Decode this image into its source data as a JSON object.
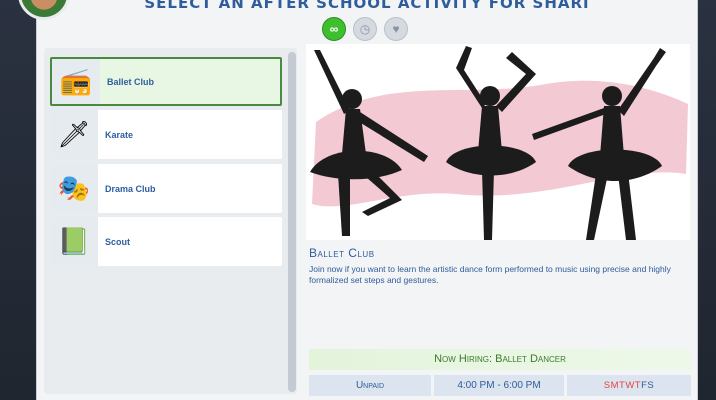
{
  "window": {
    "title": "Select an After School Activity for Shari"
  },
  "mode_buttons": [
    {
      "icon": "infinity-icon",
      "glyph": "∞",
      "active": true
    },
    {
      "icon": "clock-icon",
      "glyph": "◷",
      "active": false
    },
    {
      "icon": "heart-icon",
      "glyph": "♥",
      "active": false
    }
  ],
  "activities": [
    {
      "label": "Ballet Club",
      "icon": "boombox-icon",
      "glyph": "📻",
      "selected": true
    },
    {
      "label": "Karate",
      "icon": "sword-icon",
      "glyph": "🗡",
      "selected": false
    },
    {
      "label": "Drama Club",
      "icon": "masks-icon",
      "glyph": "🎭",
      "selected": false
    },
    {
      "label": "Scout",
      "icon": "scout-book-icon",
      "glyph": "📗",
      "selected": false
    }
  ],
  "detail": {
    "title": "Ballet Club",
    "description": "Join now if you want to learn the artistic dance form performed to music using precise and highly formalized set steps and gestures.",
    "hiring": "Now Hiring: Ballet Dancer",
    "pay": "Unpaid",
    "hours": "4:00 PM - 6:00 PM",
    "days": [
      {
        "d": "S",
        "on": true
      },
      {
        "d": "M",
        "on": true
      },
      {
        "d": "T",
        "on": true
      },
      {
        "d": "W",
        "on": true
      },
      {
        "d": "T",
        "on": true
      },
      {
        "d": "F",
        "on": false
      },
      {
        "d": "S",
        "on": false
      }
    ]
  },
  "colors": {
    "accent": "#2f5c9a",
    "selected_border": "#4a8a3f",
    "day_active": "#e04646",
    "brush": "#f3c9d3"
  }
}
